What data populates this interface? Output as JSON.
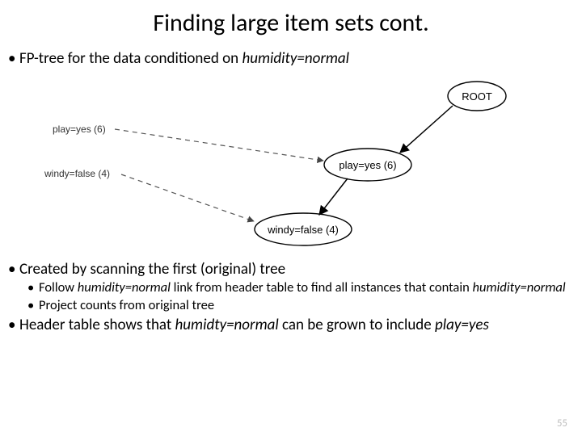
{
  "title": "Finding large item sets cont.",
  "bullet1_a": "FP-tree for the data conditioned on ",
  "bullet1_b": "humidity=normal",
  "bullet2": "Created by scanning the first (original) tree",
  "bullet2_1a": "Follow ",
  "bullet2_1b": "humidity=normal",
  "bullet2_1c": " link from header table to find all instances that contain ",
  "bullet2_1d": "humidity=normal",
  "bullet2_2": "Project counts from original tree",
  "bullet3_a": "Header table shows that ",
  "bullet3_b": "humidty=normal",
  "bullet3_c": " can be grown to include ",
  "bullet3_d": "play=yes",
  "pagenum": "55",
  "diagram": {
    "root_label": "ROOT",
    "node_play": "play=yes (6)",
    "node_windy": "windy=false (4)",
    "header_play": "play=yes (6)",
    "header_windy": "windy=false (4)"
  },
  "chart_data": {
    "type": "tree",
    "title": "FP-tree conditioned on humidity=normal",
    "nodes": [
      {
        "id": "root",
        "label": "ROOT"
      },
      {
        "id": "play_yes",
        "label": "play=yes",
        "count": 6
      },
      {
        "id": "windy_false",
        "label": "windy=false",
        "count": 4
      }
    ],
    "edges": [
      {
        "from": "root",
        "to": "play_yes",
        "style": "solid"
      },
      {
        "from": "play_yes",
        "to": "windy_false",
        "style": "solid"
      }
    ],
    "header_table": [
      {
        "item": "play=yes",
        "count": 6,
        "link_to_node": "play_yes"
      },
      {
        "item": "windy=false",
        "count": 4,
        "link_to_node": "windy_false"
      }
    ],
    "header_links": [
      {
        "from_header": "play=yes",
        "to_node": "play_yes",
        "style": "dashed"
      },
      {
        "from_header": "windy=false",
        "to_node": "windy_false",
        "style": "dashed"
      }
    ]
  }
}
